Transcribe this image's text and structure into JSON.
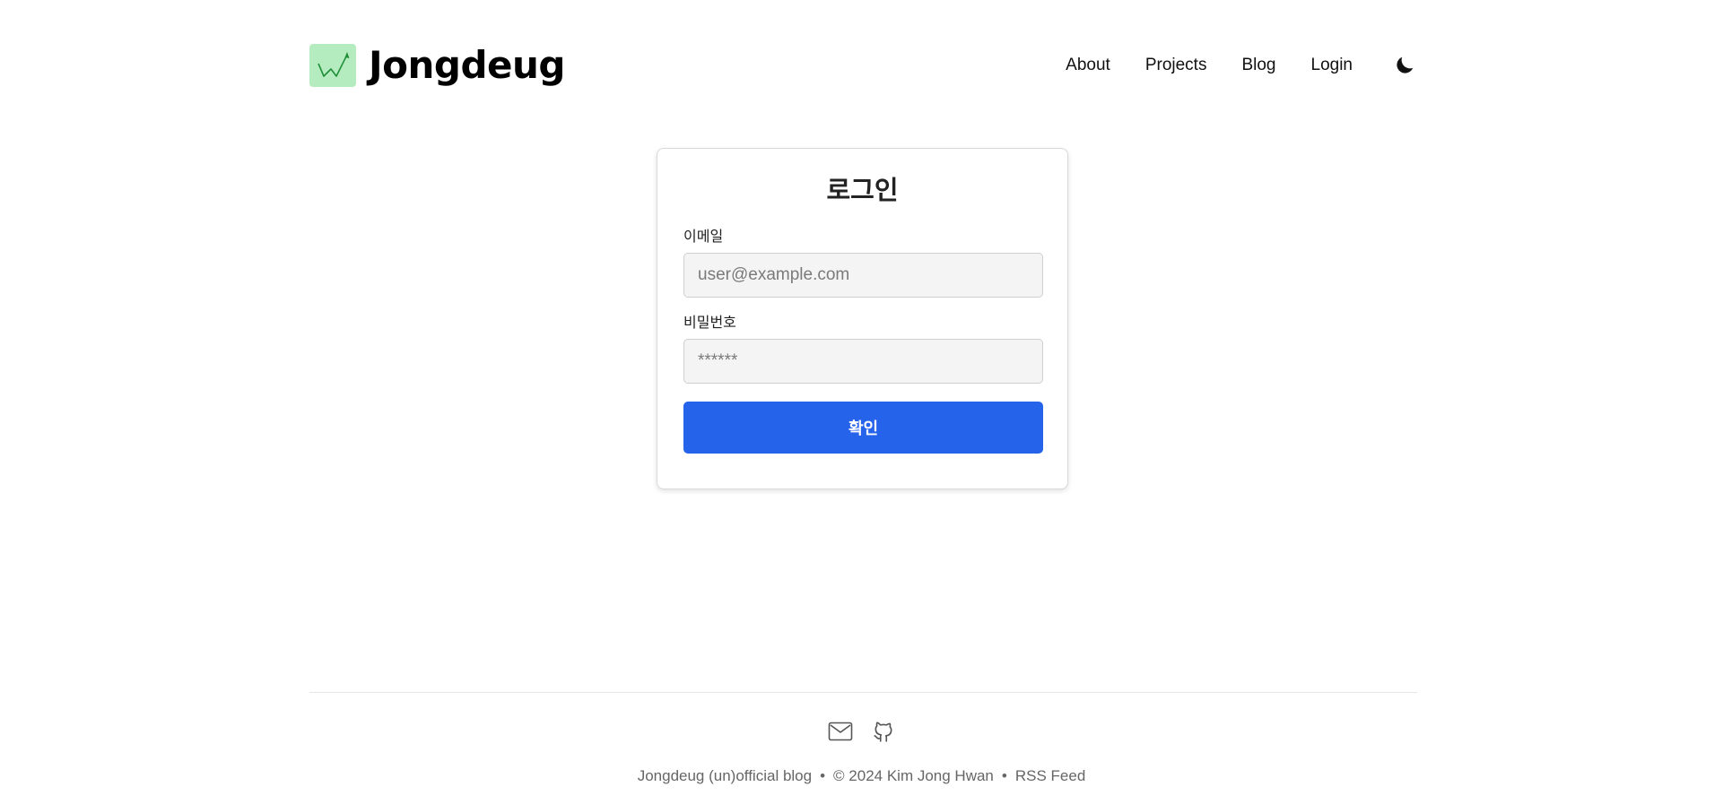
{
  "header": {
    "brand": {
      "name": "Jongdeug",
      "logo_icon": "trend-chart-icon"
    },
    "nav": [
      {
        "label": "About"
      },
      {
        "label": "Projects"
      },
      {
        "label": "Blog"
      },
      {
        "label": "Login"
      }
    ],
    "theme_toggle_icon": "moon-icon"
  },
  "login": {
    "title": "로그인",
    "email": {
      "label": "이메일",
      "placeholder": "user@example.com",
      "value": ""
    },
    "password": {
      "label": "비밀번호",
      "placeholder": "******",
      "value": ""
    },
    "submit_label": "확인"
  },
  "footer": {
    "icons": [
      "mail-icon",
      "github-icon"
    ],
    "blog_name": "Jongdeug (un)official blog",
    "separator": "•",
    "copyright": "© 2024 Kim Jong Hwan",
    "rss": "RSS Feed"
  },
  "colors": {
    "accent": "#2563eb",
    "logo_bg": "#b5ecbf",
    "logo_line": "#1f8f3a"
  }
}
